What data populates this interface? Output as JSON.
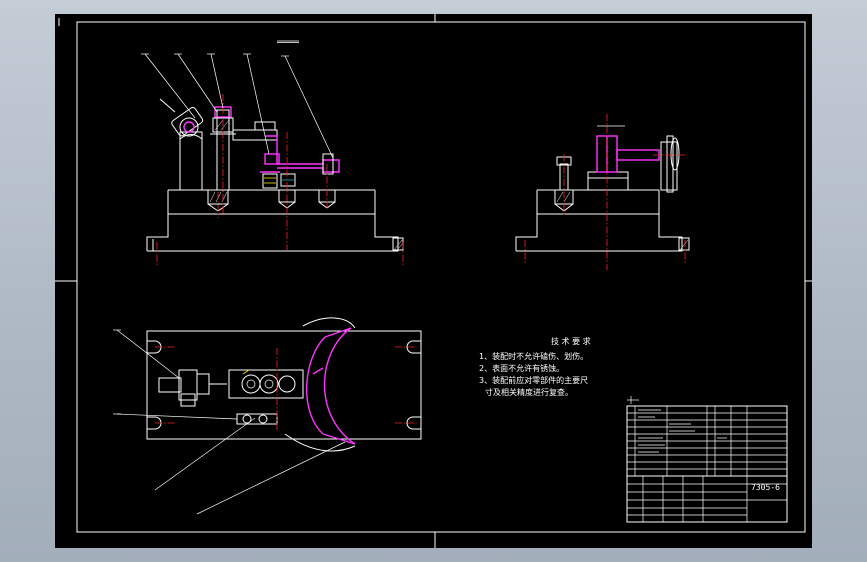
{
  "title_block": {
    "drawing_number": "7305-6"
  },
  "technical_requirements": {
    "heading": "技 术 要 求",
    "items": [
      "1、装配时不允许磕伤、划伤。",
      "2、表面不允许有锈蚀。",
      "3、装配前应对零部件的主要尺",
      "寸及相关精度进行复查。"
    ]
  },
  "colors": {
    "sheet": "#000000",
    "outline": "#ffffff",
    "part_highlight": "#ff33ff",
    "centerline": "#ff2020",
    "annotation": "#f2e600"
  }
}
